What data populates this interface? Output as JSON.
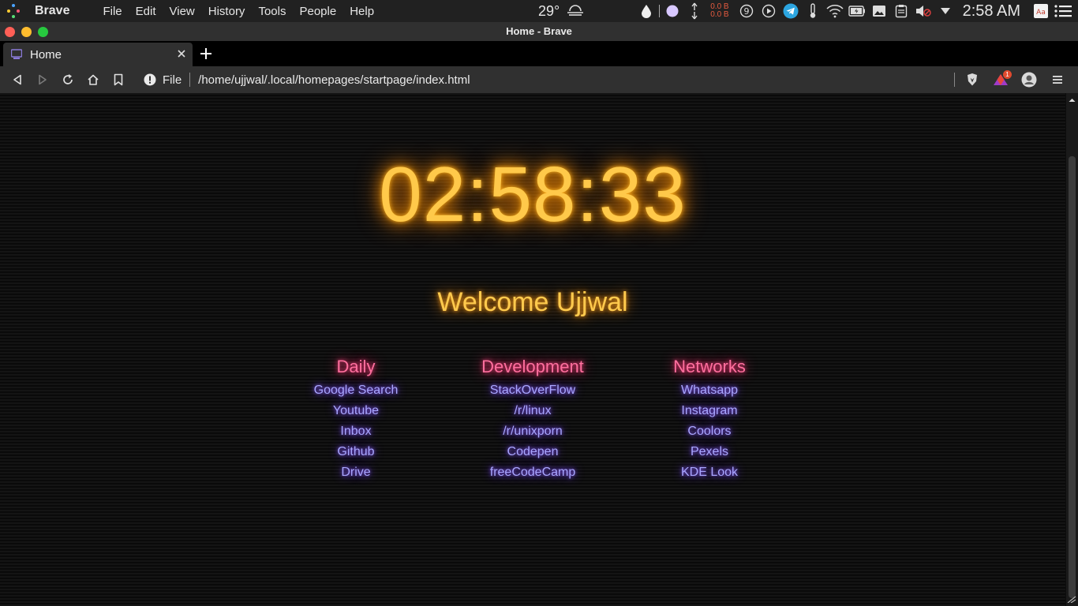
{
  "system_bar": {
    "app_name": "Brave",
    "menu": [
      "File",
      "Edit",
      "View",
      "History",
      "Tools",
      "People",
      "Help"
    ],
    "weather_temp": "29°",
    "net_up": "0.0 B",
    "net_down": "0.0 B",
    "clock": "2:58 AM",
    "icons": [
      "weather-icon",
      "droplet-icon",
      "moon-icon",
      "network-arrows-icon",
      "notification-9-icon",
      "play-icon",
      "telegram-icon",
      "thermometer-icon",
      "wifi-icon",
      "battery-icon",
      "image-icon",
      "clipboard-icon",
      "volume-muted-icon",
      "dropdown-triangle-icon",
      "dictionary-icon",
      "menu-list-icon"
    ]
  },
  "window": {
    "title": "Home - Brave"
  },
  "tabs": [
    {
      "label": "Home",
      "active": true
    }
  ],
  "toolbar": {
    "security_label": "File",
    "url": "/home/ujjwal/.local/homepages/startpage/index.html",
    "rewards_badge": "1"
  },
  "page": {
    "time": "02:58:33",
    "welcome": "Welcome Ujjwal",
    "columns": [
      {
        "heading": "Daily",
        "links": [
          "Google Search",
          "Youtube",
          "Inbox",
          "Github",
          "Drive"
        ]
      },
      {
        "heading": "Development",
        "links": [
          "StackOverFlow",
          "/r/linux",
          "/r/unixporn",
          "Codepen",
          "freeCodeCamp"
        ]
      },
      {
        "heading": "Networks",
        "links": [
          "Whatsapp",
          "Instagram",
          "Coolors",
          "Pexels",
          "KDE Look"
        ]
      }
    ]
  },
  "colors": {
    "clock": "#ffc94a",
    "headings": "#ff6f9e",
    "links": "#a9a6ff"
  }
}
